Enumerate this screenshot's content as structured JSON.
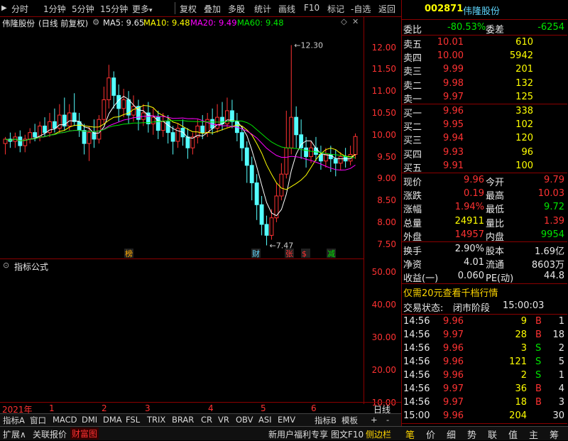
{
  "toolbar": {
    "items": [
      "分时",
      "1分钟",
      "5分钟",
      "15分钟",
      "更多",
      "复权",
      "叠加",
      "多股",
      "统计",
      "画线",
      "F10",
      "标记",
      "-自选",
      "返回"
    ]
  },
  "chart_header": {
    "stock_name": "伟隆股份",
    "mode": "(日线 前复权)",
    "ma5": "MA5: 9.65",
    "ma10": "MA10: 9.48",
    "ma20": "MA20: 9.49",
    "ma60": "MA60: 9.48",
    "high_marker": "12.30",
    "low_marker": "7.47"
  },
  "chart_data": {
    "type": "candlestick",
    "y_axis_ticks": [
      "12.00",
      "11.50",
      "11.00",
      "10.50",
      "10.00",
      "9.50",
      "9.00",
      "8.50",
      "8.00",
      "7.50"
    ],
    "indicator_ticks": [
      "50.00",
      "40.00",
      "30.00",
      "20.00",
      "10.00"
    ],
    "x_axis_labels": [
      "2021年",
      "1",
      "2",
      "3",
      "4",
      "5",
      "6"
    ],
    "event_badges": [
      "榜",
      "财",
      "张",
      "$",
      "减"
    ],
    "ylim": [
      7.3,
      12.4
    ],
    "candles": [
      [
        9.8,
        9.9,
        9.7,
        9.95,
        9.55
      ],
      [
        9.9,
        9.85,
        9.95,
        10.05,
        9.7
      ],
      [
        9.85,
        9.95,
        9.8,
        10.05,
        9.7
      ],
      [
        9.95,
        9.75,
        9.98,
        10.1,
        9.6
      ],
      [
        9.75,
        9.9,
        9.7,
        10.0,
        9.6
      ],
      [
        9.9,
        10.05,
        9.85,
        10.15,
        9.8
      ],
      [
        10.05,
        9.95,
        10.1,
        10.25,
        9.85
      ],
      [
        9.95,
        10.2,
        9.9,
        10.3,
        9.85
      ],
      [
        10.2,
        10.05,
        10.25,
        10.4,
        9.95
      ],
      [
        10.05,
        10.3,
        10.0,
        10.5,
        9.95
      ],
      [
        10.3,
        10.15,
        10.35,
        10.6,
        10.05
      ],
      [
        10.15,
        10.45,
        10.1,
        10.7,
        10.05
      ],
      [
        10.45,
        10.2,
        10.5,
        10.85,
        10.1
      ],
      [
        10.2,
        10.5,
        10.15,
        10.7,
        10.1
      ],
      [
        10.5,
        10.3,
        10.55,
        10.95,
        10.2
      ],
      [
        10.3,
        10.1,
        10.35,
        10.5,
        9.95
      ],
      [
        10.1,
        9.8,
        10.15,
        10.25,
        9.55
      ],
      [
        9.8,
        10.05,
        9.75,
        10.2,
        9.4
      ],
      [
        10.05,
        9.9,
        10.1,
        10.35,
        9.7
      ],
      [
        9.9,
        10.35,
        9.85,
        10.45,
        9.8
      ],
      [
        10.35,
        10.8,
        10.3,
        11.1,
        10.25
      ],
      [
        10.8,
        11.3,
        10.75,
        11.6,
        10.6
      ],
      [
        11.3,
        10.9,
        11.35,
        11.45,
        10.6
      ],
      [
        10.9,
        10.6,
        10.95,
        11.15,
        10.3
      ],
      [
        10.6,
        10.8,
        10.55,
        11.05,
        10.4
      ],
      [
        10.8,
        10.45,
        10.85,
        11.0,
        10.25
      ],
      [
        10.45,
        10.65,
        10.4,
        10.9,
        10.3
      ],
      [
        10.65,
        10.35,
        10.7,
        10.8,
        10.1
      ],
      [
        10.35,
        10.5,
        10.3,
        10.7,
        10.2
      ],
      [
        10.5,
        10.25,
        10.55,
        10.75,
        10.05
      ],
      [
        10.25,
        10.4,
        10.2,
        10.6,
        10.0
      ],
      [
        10.4,
        10.1,
        10.45,
        10.55,
        9.9
      ],
      [
        10.1,
        10.3,
        10.05,
        10.5,
        9.95
      ],
      [
        10.3,
        10.05,
        10.35,
        10.45,
        9.8
      ],
      [
        10.05,
        9.85,
        10.1,
        10.2,
        9.55
      ],
      [
        9.85,
        10.15,
        9.8,
        10.25,
        9.7
      ],
      [
        10.15,
        9.95,
        10.2,
        10.35,
        9.75
      ],
      [
        9.95,
        9.7,
        10.0,
        10.15,
        9.45
      ],
      [
        9.7,
        9.95,
        9.65,
        10.05,
        9.55
      ],
      [
        9.95,
        10.2,
        9.9,
        10.35,
        9.8
      ],
      [
        10.2,
        10.05,
        10.25,
        10.45,
        9.9
      ],
      [
        10.05,
        10.35,
        10.0,
        10.5,
        9.95
      ],
      [
        10.35,
        10.15,
        10.4,
        10.6,
        10.0
      ],
      [
        10.15,
        10.4,
        10.1,
        10.7,
        10.05
      ],
      [
        10.4,
        10.25,
        10.45,
        10.75,
        10.1
      ],
      [
        10.25,
        10.55,
        10.2,
        10.85,
        10.15
      ],
      [
        10.55,
        10.3,
        10.6,
        10.8,
        10.15
      ],
      [
        10.3,
        10.05,
        10.35,
        10.5,
        9.85
      ],
      [
        10.05,
        9.7,
        10.1,
        10.2,
        9.4
      ],
      [
        9.7,
        9.3,
        9.75,
        9.85,
        8.9
      ],
      [
        9.3,
        8.9,
        9.35,
        9.5,
        8.5
      ],
      [
        8.9,
        8.4,
        8.95,
        9.1,
        8.05
      ],
      [
        8.4,
        7.95,
        8.45,
        8.6,
        7.7
      ],
      [
        7.95,
        7.7,
        8.0,
        8.15,
        7.47
      ],
      [
        7.7,
        8.1,
        7.65,
        8.3,
        7.6
      ],
      [
        8.1,
        8.6,
        8.05,
        8.9,
        8.0
      ],
      [
        8.6,
        9.1,
        8.55,
        9.35,
        8.5
      ],
      [
        9.1,
        9.7,
        9.05,
        10.55,
        9.0
      ],
      [
        9.7,
        10.4,
        9.65,
        12.05,
        9.55
      ],
      [
        10.4,
        10.0,
        10.45,
        10.65,
        9.7
      ],
      [
        10.0,
        9.7,
        10.05,
        10.35,
        9.45
      ],
      [
        9.7,
        9.5,
        9.75,
        9.95,
        9.25
      ],
      [
        9.5,
        9.7,
        9.45,
        9.85,
        9.35
      ],
      [
        9.7,
        9.55,
        9.75,
        9.95,
        9.4
      ],
      [
        9.55,
        9.4,
        9.6,
        9.75,
        9.2
      ],
      [
        9.4,
        9.55,
        9.35,
        9.7,
        9.25
      ],
      [
        9.55,
        9.45,
        9.6,
        9.75,
        9.15
      ],
      [
        9.45,
        9.35,
        9.5,
        9.65,
        9.05
      ],
      [
        9.35,
        9.5,
        9.3,
        9.6,
        9.2
      ],
      [
        9.5,
        9.4,
        9.55,
        9.7,
        9.25
      ],
      [
        9.4,
        9.55,
        9.35,
        9.75,
        9.3
      ],
      [
        9.55,
        9.96,
        9.5,
        10.03,
        9.45
      ]
    ]
  },
  "bottom_tabs": [
    "指标A",
    "窗口",
    "MACD",
    "DMI",
    "DMA",
    "FSL",
    "TRIX",
    "BRAR",
    "CR",
    "VR",
    "OBV",
    "ASI",
    "EMV",
    "指标B",
    "模板",
    "+",
    "-"
  ],
  "indicator_title": "指标公式",
  "day_line_label": "日线",
  "status_bar": {
    "left": [
      "扩展∧",
      "关联报价",
      "财富图"
    ],
    "center": [
      "新用户福利专享",
      "图文F10",
      "侧边栏"
    ],
    "right_tabs": [
      "笔",
      "价",
      "细",
      "势",
      "联",
      "值",
      "主",
      "筹"
    ]
  },
  "quote": {
    "code": "002871",
    "name": "伟隆股份",
    "weibi_label": "委比",
    "weibi_value": "-80.53%",
    "weicha_label": "委差",
    "weicha_value": "-6254",
    "asks": [
      {
        "label": "卖五",
        "price": "10.01",
        "vol": "610"
      },
      {
        "label": "卖四",
        "price": "10.00",
        "vol": "5942"
      },
      {
        "label": "卖三",
        "price": "9.99",
        "vol": "201"
      },
      {
        "label": "卖二",
        "price": "9.98",
        "vol": "132"
      },
      {
        "label": "卖一",
        "price": "9.97",
        "vol": "125"
      }
    ],
    "bids": [
      {
        "label": "买一",
        "price": "9.96",
        "vol": "338"
      },
      {
        "label": "买二",
        "price": "9.95",
        "vol": "102"
      },
      {
        "label": "买三",
        "price": "9.94",
        "vol": "120"
      },
      {
        "label": "买四",
        "price": "9.93",
        "vol": "96"
      },
      {
        "label": "买五",
        "price": "9.91",
        "vol": "100"
      }
    ],
    "stats": [
      {
        "l1": "现价",
        "v1": "9.96",
        "c1": "red",
        "l2": "今开",
        "v2": "9.79",
        "c2": "red"
      },
      {
        "l1": "涨跌",
        "v1": "0.19",
        "c1": "red",
        "l2": "最高",
        "v2": "10.03",
        "c2": "red"
      },
      {
        "l1": "涨幅",
        "v1": "1.94%",
        "c1": "red",
        "l2": "最低",
        "v2": "9.72",
        "c2": "green"
      },
      {
        "l1": "总量",
        "v1": "24911",
        "c1": "yellow",
        "l2": "量比",
        "v2": "1.39",
        "c2": "red"
      },
      {
        "l1": "外盘",
        "v1": "14957",
        "c1": "red",
        "l2": "内盘",
        "v2": "9954",
        "c2": "green"
      }
    ],
    "stats2": [
      {
        "l1": "换手",
        "v1": "2.90%",
        "l2": "股本",
        "v2": "1.69亿"
      },
      {
        "l1": "净资",
        "v1": "4.01",
        "l2": "流通",
        "v2": "8603万"
      },
      {
        "l1": "收益(一)",
        "v1": "0.060",
        "l2": "PE(动)",
        "v2": "44.8"
      }
    ],
    "promo": "仅需20元查看千档行情",
    "trade_status_label": "交易状态:",
    "trade_status_value": "闭市阶段",
    "trade_status_time": "15:00:03",
    "ticks": [
      {
        "time": "14:56",
        "price": "9.96",
        "vol": "9",
        "bs": "B",
        "n": "1"
      },
      {
        "time": "14:56",
        "price": "9.97",
        "vol": "28",
        "bs": "B",
        "n": "18"
      },
      {
        "time": "14:56",
        "price": "9.96",
        "vol": "3",
        "bs": "S",
        "n": "2"
      },
      {
        "time": "14:56",
        "price": "9.96",
        "vol": "121",
        "bs": "S",
        "n": "5"
      },
      {
        "time": "14:56",
        "price": "9.96",
        "vol": "2",
        "bs": "S",
        "n": "1"
      },
      {
        "time": "14:56",
        "price": "9.97",
        "vol": "36",
        "bs": "B",
        "n": "4"
      },
      {
        "time": "14:56",
        "price": "9.97",
        "vol": "18",
        "bs": "B",
        "n": "3"
      },
      {
        "time": "15:00",
        "price": "9.96",
        "vol": "204",
        "bs": "",
        "n": "30"
      }
    ]
  },
  "colors": {
    "up": "#ff3232",
    "down": "#54ffff",
    "ma5": "#ffffff",
    "ma10": "#ffff00",
    "ma20": "#ff00ff",
    "ma60": "#00e600",
    "frame": "#8b0000"
  }
}
